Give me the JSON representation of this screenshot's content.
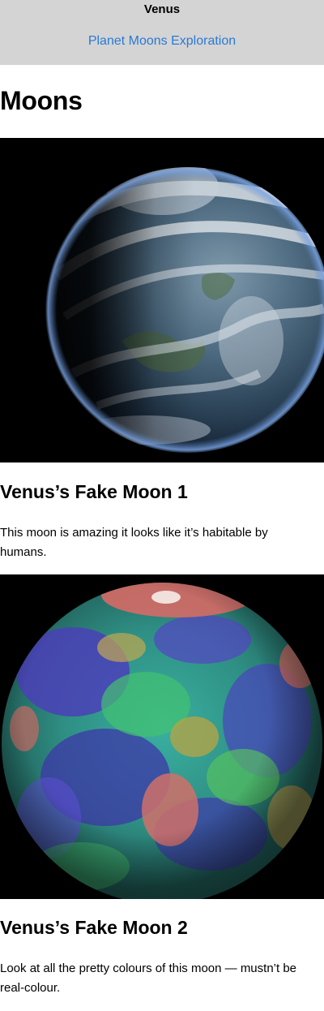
{
  "header": {
    "title": "Venus",
    "nav_link": "Planet Moons Exploration"
  },
  "page": {
    "heading": "Moons"
  },
  "moons": [
    {
      "name": "Venus’s Fake Moon 1",
      "description": "This moon is amazing it looks like it’s habitable by humans.",
      "image": "earth-like cloudy planet image"
    },
    {
      "name": "Venus’s Fake Moon 2",
      "description": "Look at all the pretty colours of this moon — mustn’t be real-colour.",
      "image": "false-colour topographic planet image"
    }
  ],
  "colors": {
    "header_bg": "#d4d4d4",
    "link": "#2a7ad5",
    "image_bg": "#000000"
  }
}
